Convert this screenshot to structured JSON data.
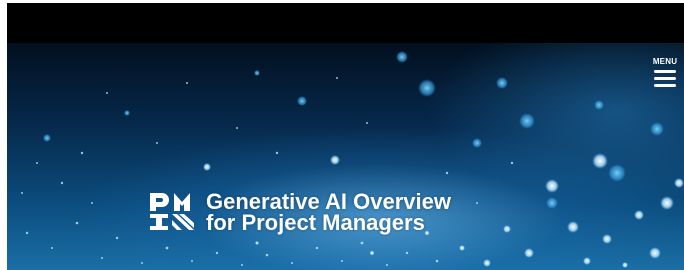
{
  "header": {
    "menu_label": "MENU",
    "menu_icon": "hamburger-icon"
  },
  "hero": {
    "logo_icon": "pmi-logo-icon",
    "title_line_1": "Generative AI Overview",
    "title_line_2": "for Project Managers"
  },
  "colors": {
    "top_bar": "#000000",
    "hero_deep": "#02101f",
    "hero_light": "#1a6fa6",
    "text": "#ffffff"
  }
}
